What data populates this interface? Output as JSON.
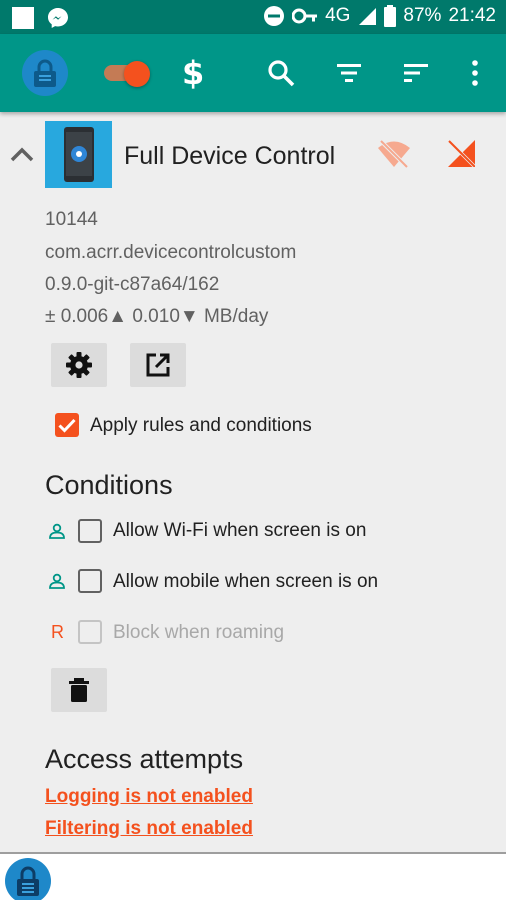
{
  "status_bar": {
    "network": "4G",
    "battery": "87%",
    "time": "21:42"
  },
  "toolbar": {
    "enabled_toggle": true,
    "icons": [
      "lock-icon",
      "dollar-icon",
      "search-icon",
      "filter-icon",
      "sort-icon",
      "more-icon"
    ],
    "dollar_glyph": "$"
  },
  "app": {
    "name": "Full Device Control",
    "uid": "10144",
    "package": "com.acrr.devicecontrolcustom",
    "version": "0.9.0-git-c87a64/162",
    "traffic": "± 0.006▲ 0.010▼ MB/day",
    "apply_rules_label": "Apply rules and conditions",
    "apply_rules_checked": true
  },
  "conditions": {
    "heading": "Conditions",
    "items": [
      {
        "label": "Allow Wi-Fi when screen is on",
        "checked": false,
        "enabled": true
      },
      {
        "label": "Allow mobile when screen is on",
        "checked": false,
        "enabled": true
      },
      {
        "prefix": "R",
        "label": "Block when roaming",
        "checked": false,
        "enabled": false
      }
    ]
  },
  "access": {
    "heading": "Access attempts",
    "logging_link": "Logging is not enabled",
    "filtering_link": "Filtering is not enabled"
  },
  "colors": {
    "status_bar": "#00796b",
    "toolbar": "#009688",
    "accent": "#f4511e",
    "background": "#eeeeee"
  }
}
